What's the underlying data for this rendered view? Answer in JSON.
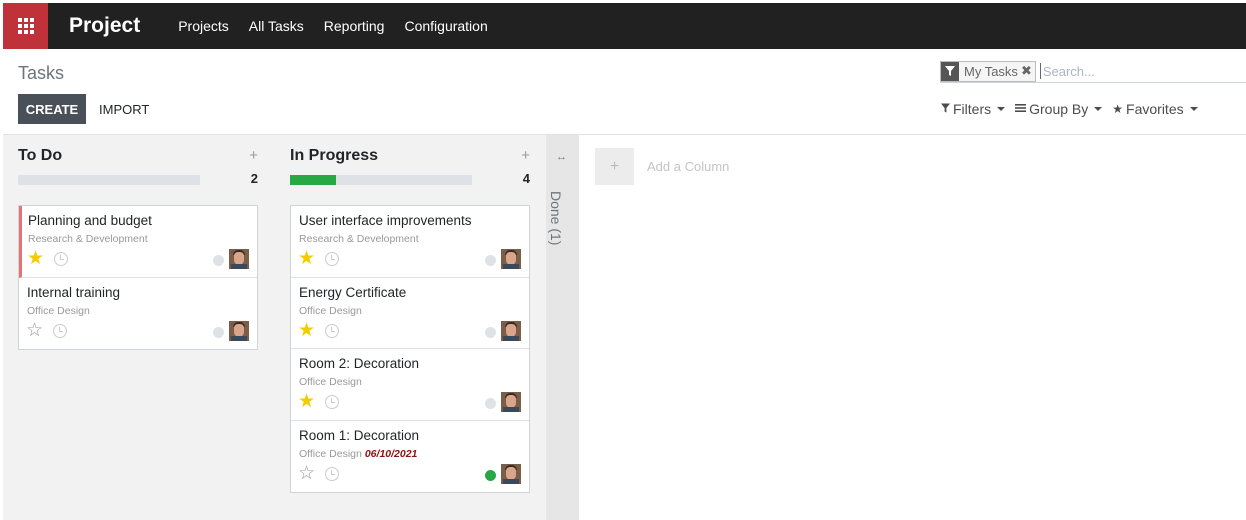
{
  "navbar": {
    "brand": "Project",
    "menu": [
      "Projects",
      "All Tasks",
      "Reporting",
      "Configuration"
    ]
  },
  "control_panel": {
    "title": "Tasks",
    "create_label": "CREATE",
    "import_label": "IMPORT",
    "search": {
      "facet": "My Tasks",
      "placeholder": "Search..."
    },
    "filters_label": "Filters",
    "groupby_label": "Group By",
    "favorites_label": "Favorites"
  },
  "columns": [
    {
      "title": "To Do",
      "count": "2",
      "progress": 0,
      "cards": [
        {
          "title": "Planning and budget",
          "project": "Research & Development",
          "starred": true,
          "status": "normal",
          "highlight": true,
          "date": ""
        },
        {
          "title": "Internal training",
          "project": "Office Design",
          "starred": false,
          "status": "normal",
          "highlight": false,
          "date": ""
        }
      ]
    },
    {
      "title": "In Progress",
      "count": "4",
      "progress": 0.25,
      "cards": [
        {
          "title": "User interface improvements",
          "project": "Research & Development",
          "starred": true,
          "status": "normal",
          "highlight": false,
          "date": ""
        },
        {
          "title": "Energy Certificate",
          "project": "Office Design",
          "starred": true,
          "status": "normal",
          "highlight": false,
          "date": ""
        },
        {
          "title": "Room 2: Decoration",
          "project": "Office Design",
          "starred": true,
          "status": "normal",
          "highlight": false,
          "date": ""
        },
        {
          "title": "Room 1: Decoration",
          "project": "Office Design",
          "starred": false,
          "status": "done",
          "highlight": false,
          "date": "06/10/2021"
        }
      ]
    }
  ],
  "folded_column": {
    "label": "Done (1)"
  },
  "add_column_label": "Add a Column",
  "colors": {
    "brand": "#c0323a",
    "navbar": "#212121",
    "progress": "#28a745",
    "star": "#f3cc00",
    "highlight": "#e57373"
  }
}
